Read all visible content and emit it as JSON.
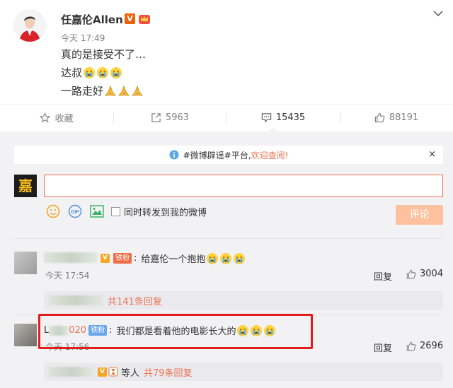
{
  "post": {
    "author": "任嘉伦Allen",
    "verified_badge": "V",
    "time": "今天 17:49",
    "lines": [
      "真的是接受不了…",
      "达叔",
      "一路走好"
    ],
    "emoji_names": [
      "crying-emoji",
      "pray-emoji"
    ]
  },
  "actions": {
    "favorite": "收藏",
    "repost": "5963",
    "comments": "15435",
    "likes": "88191"
  },
  "notice": {
    "topic": "#微博辟谣#平台,",
    "link": "欢迎查阅!",
    "close": "×"
  },
  "compose": {
    "avatar_text": "嘉",
    "checkbox_label": "同时转发到我的微博",
    "submit": "评论",
    "gif_label": "GIF"
  },
  "comments": [
    {
      "badge": "铁粉",
      "vip": "V",
      "text": "给嘉伦一个抱抱",
      "time": "今天 17:54",
      "reply_label": "回复",
      "likes": "3004",
      "sub_text": "共141条回复"
    },
    {
      "user_suffix": "020",
      "user_initial": "L",
      "badge": "铁粉",
      "text": "我们都是看着他的电影长大的",
      "time": "今天 17:56",
      "reply_label": "回复",
      "likes": "2696",
      "sub_prefix": "等人",
      "sub_text": "共79条回复"
    }
  ],
  "colors": {
    "accent": "#eb7350",
    "panel_bg": "#f2f2f5",
    "highlight_box": "#e21d1d",
    "submit_disabled": "#ffc09f"
  }
}
